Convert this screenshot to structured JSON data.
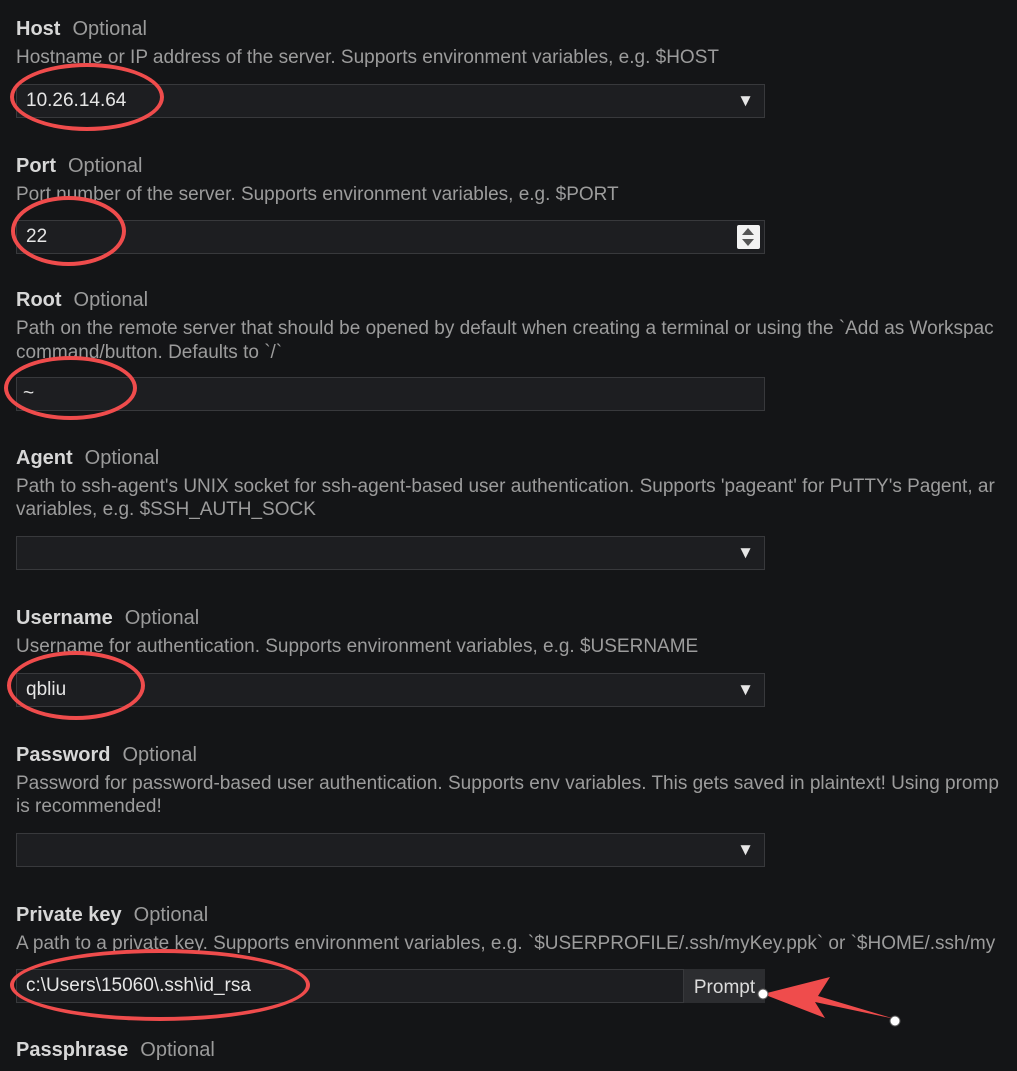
{
  "fields": {
    "host": {
      "label": "Host",
      "optional": "Optional",
      "description": "Hostname or IP address of the server. Supports environment variables, e.g. $HOST",
      "value": "10.26.14.64",
      "dropdown_icon": "triangle-down-icon",
      "dropdown_glyph": "▼"
    },
    "port": {
      "label": "Port",
      "optional": "Optional",
      "description": "Port number of the server. Supports environment variables, e.g. $PORT",
      "value": "22",
      "stepper_icon": "up-down-stepper-icon"
    },
    "root": {
      "label": "Root",
      "optional": "Optional",
      "description_line1": "Path on the remote server that should be opened by default when creating a terminal or using the `Add as Workspac",
      "description_line2": "command/button. Defaults to `/`",
      "value": "~"
    },
    "agent": {
      "label": "Agent",
      "optional": "Optional",
      "description_line1": "Path to ssh-agent's UNIX socket for ssh-agent-based user authentication. Supports 'pageant' for PuTTY's Pagent, ar",
      "description_line2": "variables, e.g. $SSH_AUTH_SOCK",
      "value": "",
      "dropdown_glyph": "▼"
    },
    "username": {
      "label": "Username",
      "optional": "Optional",
      "description": "Username for authentication. Supports environment variables, e.g. $USERNAME",
      "value": "qbliu",
      "dropdown_glyph": "▼"
    },
    "password": {
      "label": "Password",
      "optional": "Optional",
      "description_line1": "Password for password-based user authentication. Supports env variables. This gets saved in plaintext! Using promp",
      "description_line2": "is recommended!",
      "value": "",
      "dropdown_glyph": "▼"
    },
    "private_key": {
      "label": "Private key",
      "optional": "Optional",
      "description": "A path to a private key. Supports environment variables, e.g. `$USERPROFILE/.ssh/myKey.ppk` or `$HOME/.ssh/my",
      "value": "c:\\Users\\15060\\.ssh\\id_rsa",
      "prompt_label": "Prompt"
    },
    "passphrase": {
      "label": "Passphrase",
      "optional": "Optional"
    }
  },
  "annotations": {
    "color": "#ef4c4c",
    "circle_icon": "red-ellipse-highlight",
    "arrow_icon": "red-arrow-annotation"
  }
}
